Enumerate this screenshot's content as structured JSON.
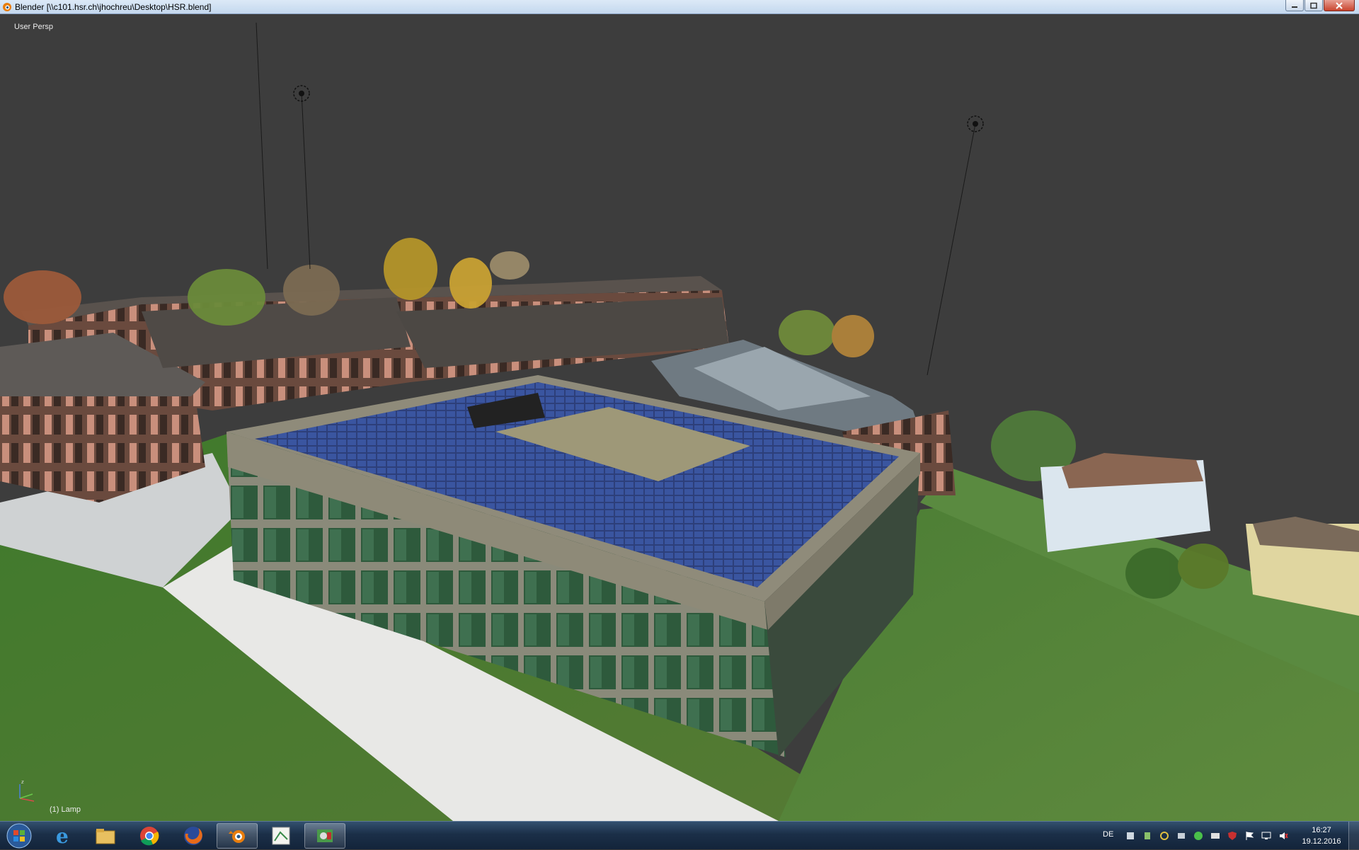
{
  "window": {
    "title": "Blender [\\\\c101.hsr.ch\\jhochreu\\Desktop\\HSR.blend]",
    "icon": "blender-icon",
    "controls": [
      "minimize-icon",
      "maximize-icon",
      "close-icon"
    ]
  },
  "viewport": {
    "view_label": "User Persp",
    "object_label": "(1) Lamp",
    "background_color": "#3d3d3d",
    "lamps": 2,
    "scene": "photogrammetry mesh of campus building with solar panel roof"
  },
  "taskbar": {
    "start_icon": "windows-start-icon",
    "apps": [
      {
        "name": "internet-explorer-icon",
        "active": false
      },
      {
        "name": "file-explorer-icon",
        "active": false
      },
      {
        "name": "chrome-icon",
        "active": false
      },
      {
        "name": "firefox-icon",
        "active": false
      },
      {
        "name": "blender-icon",
        "active": true
      },
      {
        "name": "pix4d-icon",
        "active": false
      },
      {
        "name": "tools-icon",
        "active": true
      }
    ],
    "tray": {
      "language": "DE",
      "icons": [
        "network-sharing-icon",
        "device-icon",
        "sync-icon",
        "network-icon",
        "app-icon",
        "display-icon",
        "shield-icon",
        "flag-icon",
        "monitor-icon",
        "volume-icon"
      ],
      "time": "16:27",
      "date": "19.12.2016"
    }
  }
}
